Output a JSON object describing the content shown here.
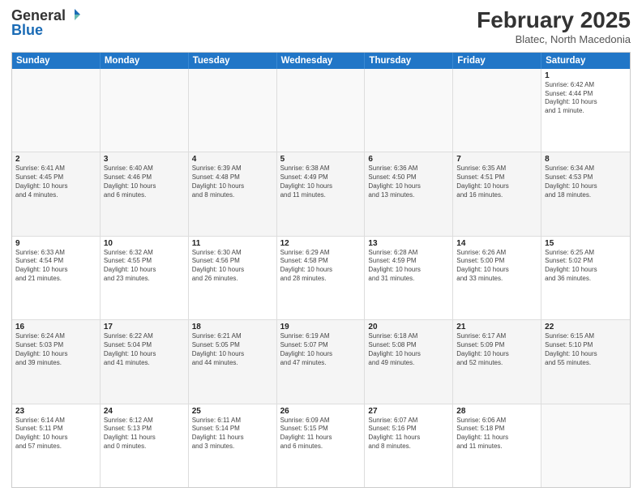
{
  "header": {
    "logo_general": "General",
    "logo_blue": "Blue",
    "month_year": "February 2025",
    "location": "Blatec, North Macedonia"
  },
  "day_headers": [
    "Sunday",
    "Monday",
    "Tuesday",
    "Wednesday",
    "Thursday",
    "Friday",
    "Saturday"
  ],
  "weeks": [
    {
      "alt": false,
      "days": [
        {
          "num": "",
          "info": ""
        },
        {
          "num": "",
          "info": ""
        },
        {
          "num": "",
          "info": ""
        },
        {
          "num": "",
          "info": ""
        },
        {
          "num": "",
          "info": ""
        },
        {
          "num": "",
          "info": ""
        },
        {
          "num": "1",
          "info": "Sunrise: 6:42 AM\nSunset: 4:44 PM\nDaylight: 10 hours\nand 1 minute."
        }
      ]
    },
    {
      "alt": true,
      "days": [
        {
          "num": "2",
          "info": "Sunrise: 6:41 AM\nSunset: 4:45 PM\nDaylight: 10 hours\nand 4 minutes."
        },
        {
          "num": "3",
          "info": "Sunrise: 6:40 AM\nSunset: 4:46 PM\nDaylight: 10 hours\nand 6 minutes."
        },
        {
          "num": "4",
          "info": "Sunrise: 6:39 AM\nSunset: 4:48 PM\nDaylight: 10 hours\nand 8 minutes."
        },
        {
          "num": "5",
          "info": "Sunrise: 6:38 AM\nSunset: 4:49 PM\nDaylight: 10 hours\nand 11 minutes."
        },
        {
          "num": "6",
          "info": "Sunrise: 6:36 AM\nSunset: 4:50 PM\nDaylight: 10 hours\nand 13 minutes."
        },
        {
          "num": "7",
          "info": "Sunrise: 6:35 AM\nSunset: 4:51 PM\nDaylight: 10 hours\nand 16 minutes."
        },
        {
          "num": "8",
          "info": "Sunrise: 6:34 AM\nSunset: 4:53 PM\nDaylight: 10 hours\nand 18 minutes."
        }
      ]
    },
    {
      "alt": false,
      "days": [
        {
          "num": "9",
          "info": "Sunrise: 6:33 AM\nSunset: 4:54 PM\nDaylight: 10 hours\nand 21 minutes."
        },
        {
          "num": "10",
          "info": "Sunrise: 6:32 AM\nSunset: 4:55 PM\nDaylight: 10 hours\nand 23 minutes."
        },
        {
          "num": "11",
          "info": "Sunrise: 6:30 AM\nSunset: 4:56 PM\nDaylight: 10 hours\nand 26 minutes."
        },
        {
          "num": "12",
          "info": "Sunrise: 6:29 AM\nSunset: 4:58 PM\nDaylight: 10 hours\nand 28 minutes."
        },
        {
          "num": "13",
          "info": "Sunrise: 6:28 AM\nSunset: 4:59 PM\nDaylight: 10 hours\nand 31 minutes."
        },
        {
          "num": "14",
          "info": "Sunrise: 6:26 AM\nSunset: 5:00 PM\nDaylight: 10 hours\nand 33 minutes."
        },
        {
          "num": "15",
          "info": "Sunrise: 6:25 AM\nSunset: 5:02 PM\nDaylight: 10 hours\nand 36 minutes."
        }
      ]
    },
    {
      "alt": true,
      "days": [
        {
          "num": "16",
          "info": "Sunrise: 6:24 AM\nSunset: 5:03 PM\nDaylight: 10 hours\nand 39 minutes."
        },
        {
          "num": "17",
          "info": "Sunrise: 6:22 AM\nSunset: 5:04 PM\nDaylight: 10 hours\nand 41 minutes."
        },
        {
          "num": "18",
          "info": "Sunrise: 6:21 AM\nSunset: 5:05 PM\nDaylight: 10 hours\nand 44 minutes."
        },
        {
          "num": "19",
          "info": "Sunrise: 6:19 AM\nSunset: 5:07 PM\nDaylight: 10 hours\nand 47 minutes."
        },
        {
          "num": "20",
          "info": "Sunrise: 6:18 AM\nSunset: 5:08 PM\nDaylight: 10 hours\nand 49 minutes."
        },
        {
          "num": "21",
          "info": "Sunrise: 6:17 AM\nSunset: 5:09 PM\nDaylight: 10 hours\nand 52 minutes."
        },
        {
          "num": "22",
          "info": "Sunrise: 6:15 AM\nSunset: 5:10 PM\nDaylight: 10 hours\nand 55 minutes."
        }
      ]
    },
    {
      "alt": false,
      "days": [
        {
          "num": "23",
          "info": "Sunrise: 6:14 AM\nSunset: 5:11 PM\nDaylight: 10 hours\nand 57 minutes."
        },
        {
          "num": "24",
          "info": "Sunrise: 6:12 AM\nSunset: 5:13 PM\nDaylight: 11 hours\nand 0 minutes."
        },
        {
          "num": "25",
          "info": "Sunrise: 6:11 AM\nSunset: 5:14 PM\nDaylight: 11 hours\nand 3 minutes."
        },
        {
          "num": "26",
          "info": "Sunrise: 6:09 AM\nSunset: 5:15 PM\nDaylight: 11 hours\nand 6 minutes."
        },
        {
          "num": "27",
          "info": "Sunrise: 6:07 AM\nSunset: 5:16 PM\nDaylight: 11 hours\nand 8 minutes."
        },
        {
          "num": "28",
          "info": "Sunrise: 6:06 AM\nSunset: 5:18 PM\nDaylight: 11 hours\nand 11 minutes."
        },
        {
          "num": "",
          "info": ""
        }
      ]
    }
  ]
}
